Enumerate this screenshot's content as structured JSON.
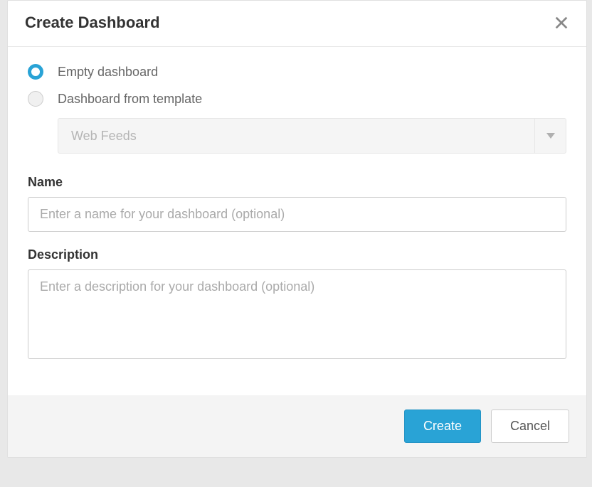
{
  "modal": {
    "title": "Create Dashboard"
  },
  "radios": {
    "empty": {
      "label": "Empty dashboard",
      "selected": true
    },
    "template": {
      "label": "Dashboard from template",
      "selected": false
    }
  },
  "template_dropdown": {
    "selected": "Web Feeds"
  },
  "fields": {
    "name": {
      "label": "Name",
      "placeholder": "Enter a name for your dashboard (optional)",
      "value": ""
    },
    "description": {
      "label": "Description",
      "placeholder": "Enter a description for your dashboard (optional)",
      "value": ""
    }
  },
  "buttons": {
    "create": "Create",
    "cancel": "Cancel"
  }
}
